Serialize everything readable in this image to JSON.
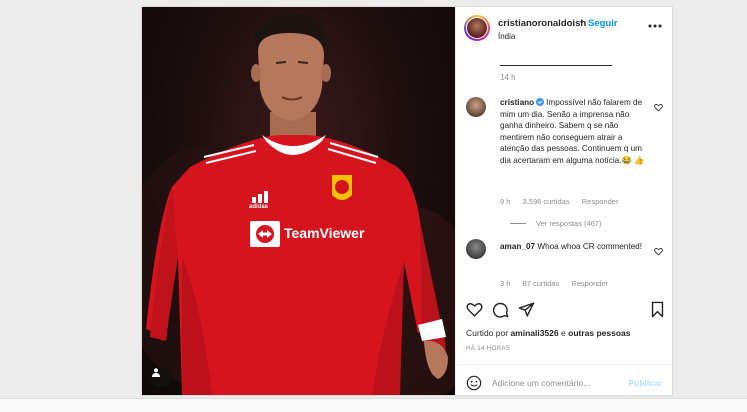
{
  "post": {
    "username": "cristianoronaldoish",
    "separator": "•",
    "follow_label": "Seguir",
    "location": "Índia",
    "caption_time": "14 h"
  },
  "comments": [
    {
      "user": "cristiano",
      "verified": true,
      "text": "Impossível não falarem de mim um dia. Senão a imprensa não ganha dinheiro. Sabem q se não mentirem não conseguem atrair a atenção das pessoas. Continuem q um dia acertaram em alguma notícia.😂 👍",
      "time": "9 h",
      "likes": "3.596 curtidas",
      "reply_label": "Responder",
      "view_replies": "Ver respostas (467)"
    },
    {
      "user": "aman_07",
      "verified": false,
      "text": "Whoa whoa CR commented!",
      "time": "3 h",
      "likes": "87 curtidas",
      "reply_label": "Responder"
    }
  ],
  "likes_line": {
    "prefix": "Curtido por",
    "user": "aminali3526",
    "joiner": "e",
    "others": "outras pessoas"
  },
  "posted_ago": "HÁ 14 HORAS",
  "add_comment": {
    "placeholder": "Adicione um comentário...",
    "publish_label": "Publicar"
  },
  "photo": {
    "jersey_sponsor": "TeamViewer",
    "kit_brand": "adidas"
  },
  "colors": {
    "link_blue": "#0095f6",
    "publish_disabled": "#b2dffc",
    "verified_blue": "#3897f0",
    "jersey_red": "#d6141e"
  },
  "icons": [
    "more-options-icon",
    "verified-icon",
    "heart-icon",
    "comment-icon",
    "share-icon",
    "bookmark-icon",
    "emoji-icon",
    "user-tag-icon"
  ]
}
